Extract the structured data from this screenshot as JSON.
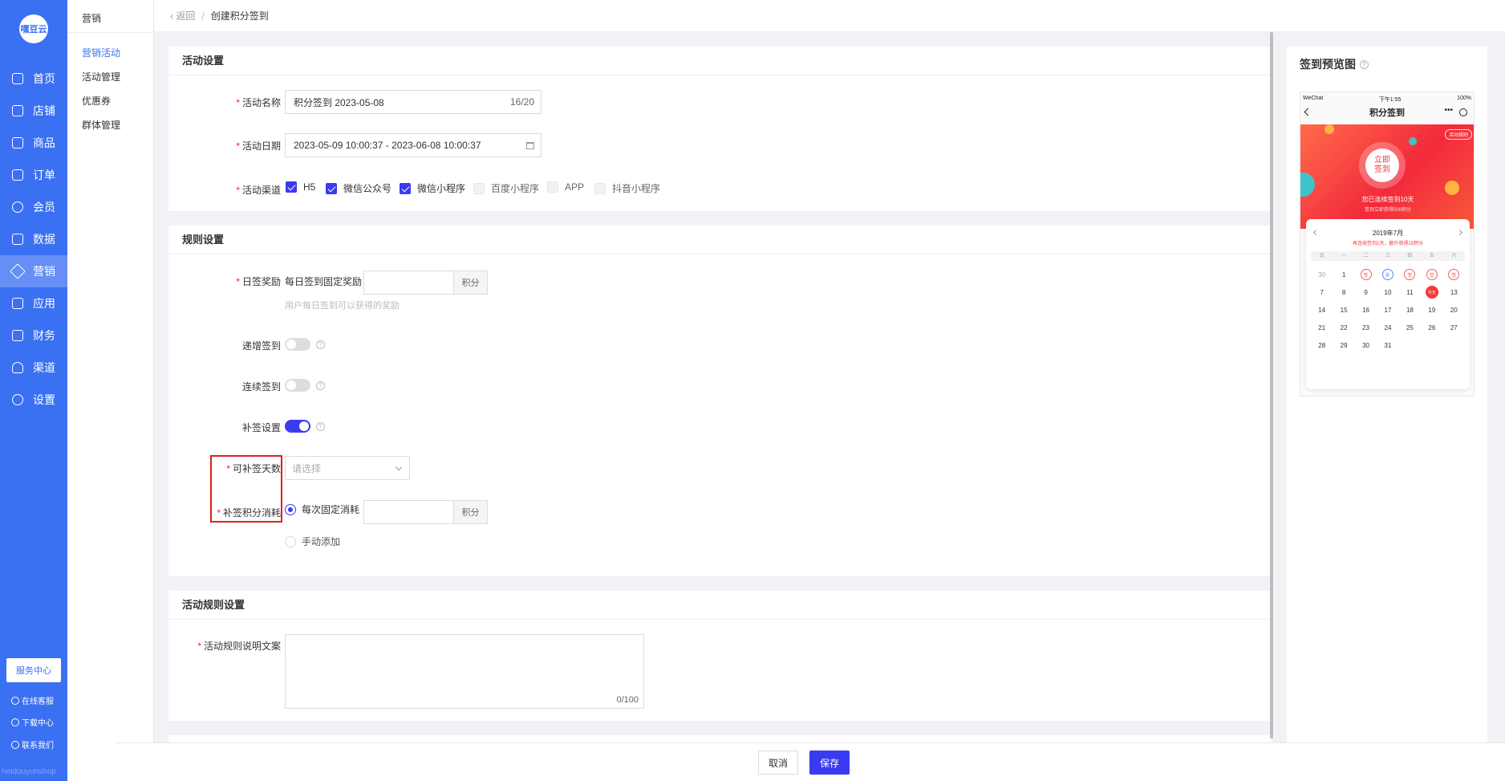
{
  "nav": {
    "logo": "嘿豆云",
    "items": [
      {
        "label": "首页",
        "icon": "home-icon"
      },
      {
        "label": "店铺",
        "icon": "shop-icon"
      },
      {
        "label": "商品",
        "icon": "goods-icon"
      },
      {
        "label": "订单",
        "icon": "order-icon"
      },
      {
        "label": "会员",
        "icon": "member-icon"
      },
      {
        "label": "数据",
        "icon": "data-icon"
      },
      {
        "label": "营销",
        "icon": "tag-icon"
      },
      {
        "label": "应用",
        "icon": "app-icon"
      },
      {
        "label": "财务",
        "icon": "finance-icon"
      },
      {
        "label": "渠道",
        "icon": "channel-icon"
      },
      {
        "label": "设置",
        "icon": "gear-icon"
      }
    ],
    "service_center": "服务中心",
    "online_service": "在线客服",
    "download": "下载中心",
    "contact": "联系我们",
    "watermark": "heidouyunshop"
  },
  "subnav": {
    "title": "营销",
    "items": [
      "营销活动",
      "活动管理",
      "优惠券",
      "群体管理"
    ]
  },
  "breadcrumb": {
    "back": "返回",
    "current": "创建积分签到"
  },
  "activity": {
    "title": "活动设置",
    "name_label": "活动名称",
    "name_value": "积分签到  2023-05-08",
    "name_count": "16/20",
    "date_label": "活动日期",
    "date_value": "2023-05-09 10:00:37 - 2023-06-08 10:00:37",
    "channel_label": "活动渠道",
    "channels": [
      {
        "label": "H5",
        "checked": true
      },
      {
        "label": "微信公众号",
        "checked": true
      },
      {
        "label": "微信小程序",
        "checked": true
      },
      {
        "label": "百度小程序",
        "checked": false
      },
      {
        "label": "APP",
        "checked": false
      },
      {
        "label": "抖音小程序",
        "checked": false
      }
    ]
  },
  "rules": {
    "title": "规则设置",
    "daily_label": "日签奖励",
    "daily_text": "每日签到固定奖励",
    "daily_unit": "积分",
    "daily_hint": "用户每日签到可以获得的奖励",
    "incr_label": "递增签到",
    "incr_on": false,
    "cont_label": "连续签到",
    "cont_on": false,
    "makeup_label": "补签设置",
    "makeup_on": true,
    "makeup_days_label": "可补签天数",
    "makeup_days_placeholder": "请选择",
    "makeup_cost_label": "补签积分消耗",
    "radio_fixed": "每次固定消耗",
    "radio_manual": "手动添加",
    "cost_unit": "积分"
  },
  "activity_rules": {
    "title": "活动规则设置",
    "label": "活动规则说明文案",
    "count": "0/100"
  },
  "preview": {
    "title": "签到预览图",
    "status_left": "WeChat",
    "status_time": "下午1:55",
    "status_right": "100%",
    "page_title": "积分签到",
    "rules_tag": "活动规则",
    "sign_btn": "立即\n签到",
    "streak": "您已连续签到10天",
    "streak_sub": "签到立即获得500积分",
    "month": "2019年7月",
    "month_sub": "再连续签到2天，额外获得15积分",
    "weekdays": [
      "日",
      "一",
      "二",
      "三",
      "四",
      "五",
      "六"
    ],
    "days": [
      {
        "t": "30",
        "k": "muted"
      },
      {
        "t": "1",
        "k": ""
      },
      {
        "t": "签",
        "k": "sign"
      },
      {
        "t": "补",
        "k": "bu"
      },
      {
        "t": "签",
        "k": "sign"
      },
      {
        "t": "签",
        "k": "sign"
      },
      {
        "t": "签",
        "k": "sign"
      },
      {
        "t": "7",
        "k": ""
      },
      {
        "t": "8",
        "k": ""
      },
      {
        "t": "9",
        "k": ""
      },
      {
        "t": "10",
        "k": ""
      },
      {
        "t": "11",
        "k": ""
      },
      {
        "t": "今天",
        "k": "today"
      },
      {
        "t": "13",
        "k": ""
      },
      {
        "t": "14",
        "k": ""
      },
      {
        "t": "15",
        "k": ""
      },
      {
        "t": "16",
        "k": ""
      },
      {
        "t": "17",
        "k": ""
      },
      {
        "t": "18",
        "k": ""
      },
      {
        "t": "19",
        "k": ""
      },
      {
        "t": "20",
        "k": ""
      },
      {
        "t": "21",
        "k": ""
      },
      {
        "t": "22",
        "k": ""
      },
      {
        "t": "23",
        "k": ""
      },
      {
        "t": "24",
        "k": ""
      },
      {
        "t": "25",
        "k": ""
      },
      {
        "t": "26",
        "k": ""
      },
      {
        "t": "27",
        "k": ""
      },
      {
        "t": "28",
        "k": ""
      },
      {
        "t": "29",
        "k": ""
      },
      {
        "t": "30",
        "k": ""
      },
      {
        "t": "31",
        "k": ""
      }
    ]
  },
  "footer": {
    "cancel": "取消",
    "save": "保存"
  },
  "colors": {
    "nav_bg": "#3a70f2",
    "primary": "#3a3af0",
    "required": "#f5222d",
    "highlight_box": "#e02020"
  }
}
